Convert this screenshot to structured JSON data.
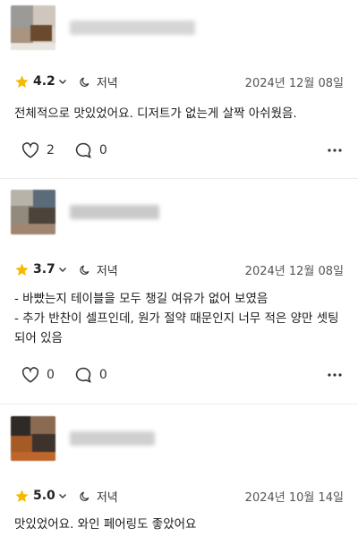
{
  "colors": {
    "star": "#f5b900",
    "divider": "#ececec",
    "text": "#1a1a1a",
    "muted": "#555555"
  },
  "icons": [
    "star-icon",
    "chevron-down-icon",
    "moon-icon",
    "heart-icon",
    "comment-icon",
    "more-icon"
  ],
  "reviews": [
    {
      "rating": "4.2",
      "time_of_day": "저녁",
      "date": "2024년 12월 08일",
      "text": "전체적으로 맛있었어요. 디저트가 없는게 살짝 아쉬웠음.",
      "likes": "2",
      "comments": "0"
    },
    {
      "rating": "3.7",
      "time_of_day": "저녁",
      "date": "2024년 12월 08일",
      "text": "- 바빴는지 테이블을 모두 챙길 여유가 없어 보였음\n- 추가 반찬이 셀프인데, 원가 절약 때문인지 너무 적은 양만 셋팅\n되어 있음",
      "likes": "0",
      "comments": "0"
    },
    {
      "rating": "5.0",
      "time_of_day": "저녁",
      "date": "2024년 10월 14일",
      "text": "맛있었어요. 와인 페어링도 좋았어요"
    }
  ]
}
